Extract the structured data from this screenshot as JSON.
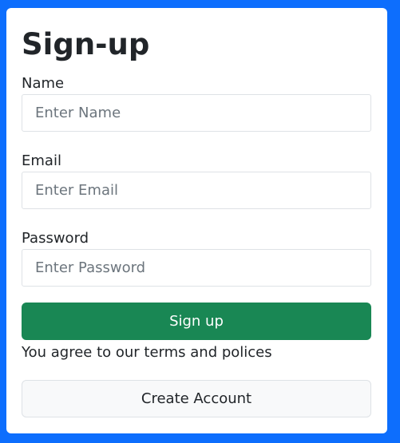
{
  "form": {
    "title": "Sign-up",
    "name_label": "Name",
    "name_placeholder": "Enter Name",
    "email_label": "Email",
    "email_placeholder": "Enter Email",
    "password_label": "Password",
    "password_placeholder": "Enter Password",
    "signup_button": "Sign up",
    "terms_text": "You agree to our terms and polices",
    "create_account_button": "Create Account"
  },
  "colors": {
    "page_background": "#0d6efd",
    "card_background": "#ffffff",
    "signup_button": "#198754",
    "create_account_button": "#f8f9fa"
  }
}
